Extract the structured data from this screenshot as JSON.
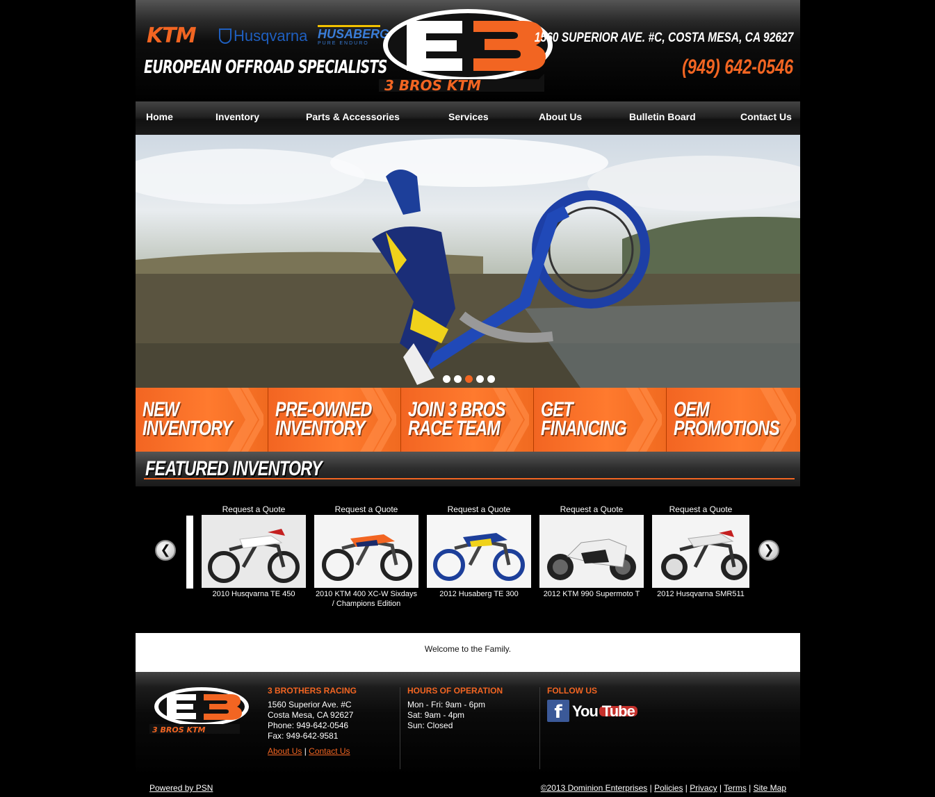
{
  "header": {
    "brands": {
      "ktm": "KTM",
      "husqvarna": "Husqvarna",
      "husaberg": "HUSABERG",
      "husaberg_sub": "PURE ENDURO"
    },
    "tagline": "EUROPEAN OFFROAD SPECIALISTS",
    "logo_text": "3 BROS KTM",
    "address": "1560 SUPERIOR AVE. #C, COSTA MESA, CA 92627",
    "phone": "(949) 642-0546"
  },
  "nav": [
    {
      "label": "Home"
    },
    {
      "label": "Inventory"
    },
    {
      "label": "Parts & Accessories"
    },
    {
      "label": "Services"
    },
    {
      "label": "About Us"
    },
    {
      "label": "Bulletin Board"
    },
    {
      "label": "Contact Us"
    }
  ],
  "hero": {
    "slides": 5,
    "active_slide": 3
  },
  "promos": [
    {
      "line1": "NEW",
      "line2": "INVENTORY"
    },
    {
      "line1": "PRE-OWNED",
      "line2": "INVENTORY"
    },
    {
      "line1": "JOIN 3 BROS",
      "line2": "RACE TEAM"
    },
    {
      "line1": "GET",
      "line2": "FINANCING"
    },
    {
      "line1": "OEM",
      "line2": "PROMOTIONS"
    }
  ],
  "featured": {
    "title": "FEATURED INVENTORY",
    "items": [
      {
        "quote": "Request a Quote",
        "name": "2010 Husqvarna TE 450"
      },
      {
        "quote": "Request a Quote",
        "name": "2010 KTM 400 XC-W Sixdays / Champions Edition"
      },
      {
        "quote": "Request a Quote",
        "name": "2012 Husaberg TE 300"
      },
      {
        "quote": "Request a Quote",
        "name": "2012 KTM 990 Supermoto T"
      },
      {
        "quote": "Request a Quote",
        "name": "2012 Husqvarna SMR511"
      }
    ]
  },
  "welcome": "Welcome to the Family.",
  "footer": {
    "company": {
      "heading": "3 BROTHERS RACING",
      "street": "1560 Superior Ave. #C",
      "city": "Costa Mesa, CA 92627",
      "phone": "Phone: 949-642-0546",
      "fax": "Fax: 949-642-9581",
      "about_link": "About Us",
      "sep": "|",
      "contact_link": "Contact Us"
    },
    "hours": {
      "heading": "HOURS OF OPERATION",
      "weekday": "Mon - Fri: 9am - 6pm",
      "sat": "Sat: 9am - 4pm",
      "sun": "Sun: Closed"
    },
    "follow": {
      "heading": "FOLLOW US",
      "facebook": "f",
      "you": "You",
      "tube": "Tube"
    },
    "powered": "Powered by PSN",
    "legal": {
      "copyright": "©2013 Dominion Enterprises",
      "policies": "Policies",
      "privacy": "Privacy",
      "terms": "Terms",
      "sitemap": "Site Map"
    }
  },
  "colors": {
    "accent": "#f26522",
    "background": "#000000",
    "facebook": "#3b5998",
    "youtube": "#c4302b"
  },
  "icons": {
    "prev": "chevron-left-icon",
    "next": "chevron-right-icon"
  }
}
